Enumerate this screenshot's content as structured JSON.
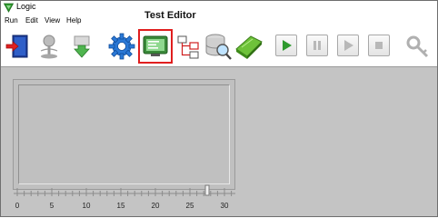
{
  "window": {
    "title": "Logic"
  },
  "menu": {
    "items": [
      "Run",
      "Edit",
      "View",
      "Help"
    ]
  },
  "callout": {
    "label": "Test Editor"
  },
  "toolbar": {
    "buttons": [
      "exit-door-icon",
      "tree-icon",
      "download-icon",
      "gear-icon",
      "test-editor-icon",
      "hierarchy-icon",
      "database-search-icon",
      "gem-icon"
    ],
    "playback": [
      "run",
      "pause",
      "step",
      "stop"
    ],
    "key": "key-icon"
  },
  "ruler": {
    "labels": [
      "0",
      "5",
      "10",
      "15",
      "20",
      "25",
      "30"
    ],
    "slider_value": 27.5
  },
  "colors": {
    "accent": "#2e9a2e",
    "highlight": "#e01e1e",
    "background": "#c4c4c4"
  }
}
